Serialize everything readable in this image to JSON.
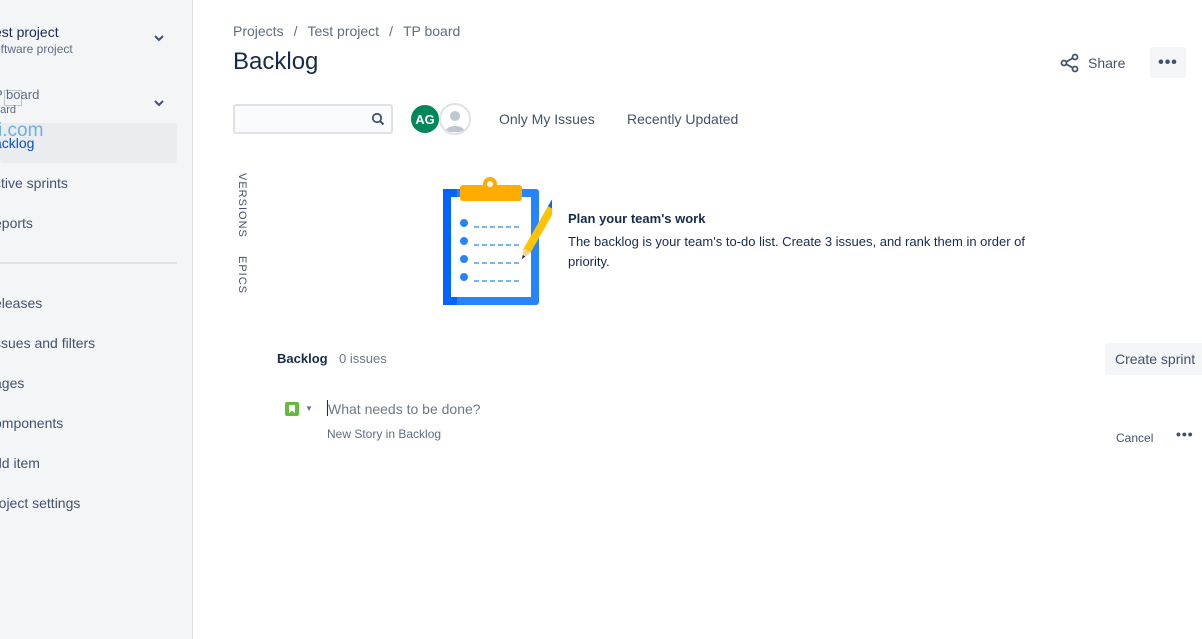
{
  "sidebar": {
    "project_name": "est project",
    "project_type": "oftware project",
    "board_name": "P board",
    "board_sub": "oard",
    "watermark": "i.com",
    "items": [
      {
        "label": "acklog",
        "active": true
      },
      {
        "label": "ctive sprints"
      },
      {
        "label": "eports"
      },
      {
        "label": "eleases"
      },
      {
        "label": "ssues and filters"
      },
      {
        "label": "ages"
      },
      {
        "label": "omponents"
      },
      {
        "label": "dd item"
      },
      {
        "label": "roject settings"
      }
    ]
  },
  "breadcrumb": [
    "Projects",
    "Test project",
    "TP board"
  ],
  "breadcrumb_sep": "/",
  "page_title": "Backlog",
  "share_label": "Share",
  "more_label": "•••",
  "search": {
    "value": "",
    "placeholder": ""
  },
  "avatar_initials": "AG",
  "filters": [
    "Only My Issues",
    "Recently Updated"
  ],
  "side_tabs": [
    "VERSIONS",
    "EPICS"
  ],
  "empty_state": {
    "title": "Plan your team's work",
    "description": "The backlog is your team's to-do list. Create 3 issues, and rank them in order of priority."
  },
  "backlog": {
    "heading": "Backlog",
    "count": "0 issues",
    "create_sprint": "Create sprint",
    "new_issue_placeholder": "What needs to be done?",
    "new_issue_hint": "New Story in Backlog",
    "cancel": "Cancel",
    "row_more": "•••"
  },
  "colors": {
    "accent": "#0052cc",
    "avatar": "#00875a",
    "story": "#63ba3c"
  }
}
